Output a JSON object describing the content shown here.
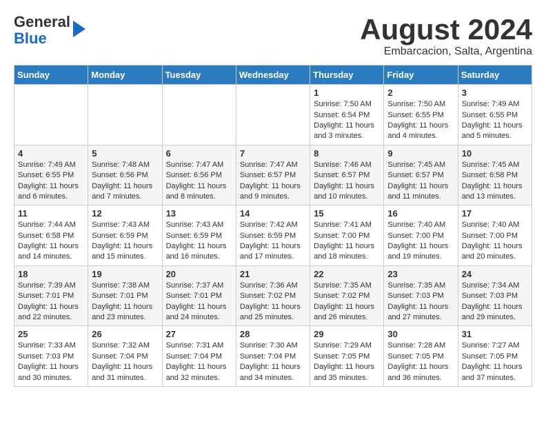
{
  "header": {
    "logo_general": "General",
    "logo_blue": "Blue",
    "month_title": "August 2024",
    "subtitle": "Embarcacion, Salta, Argentina"
  },
  "days_of_week": [
    "Sunday",
    "Monday",
    "Tuesday",
    "Wednesday",
    "Thursday",
    "Friday",
    "Saturday"
  ],
  "weeks": [
    [
      {
        "day": "",
        "content": ""
      },
      {
        "day": "",
        "content": ""
      },
      {
        "day": "",
        "content": ""
      },
      {
        "day": "",
        "content": ""
      },
      {
        "day": "1",
        "content": "Sunrise: 7:50 AM\nSunset: 6:54 PM\nDaylight: 11 hours\nand 3 minutes."
      },
      {
        "day": "2",
        "content": "Sunrise: 7:50 AM\nSunset: 6:55 PM\nDaylight: 11 hours\nand 4 minutes."
      },
      {
        "day": "3",
        "content": "Sunrise: 7:49 AM\nSunset: 6:55 PM\nDaylight: 11 hours\nand 5 minutes."
      }
    ],
    [
      {
        "day": "4",
        "content": "Sunrise: 7:49 AM\nSunset: 6:55 PM\nDaylight: 11 hours\nand 6 minutes."
      },
      {
        "day": "5",
        "content": "Sunrise: 7:48 AM\nSunset: 6:56 PM\nDaylight: 11 hours\nand 7 minutes."
      },
      {
        "day": "6",
        "content": "Sunrise: 7:47 AM\nSunset: 6:56 PM\nDaylight: 11 hours\nand 8 minutes."
      },
      {
        "day": "7",
        "content": "Sunrise: 7:47 AM\nSunset: 6:57 PM\nDaylight: 11 hours\nand 9 minutes."
      },
      {
        "day": "8",
        "content": "Sunrise: 7:46 AM\nSunset: 6:57 PM\nDaylight: 11 hours\nand 10 minutes."
      },
      {
        "day": "9",
        "content": "Sunrise: 7:45 AM\nSunset: 6:57 PM\nDaylight: 11 hours\nand 11 minutes."
      },
      {
        "day": "10",
        "content": "Sunrise: 7:45 AM\nSunset: 6:58 PM\nDaylight: 11 hours\nand 13 minutes."
      }
    ],
    [
      {
        "day": "11",
        "content": "Sunrise: 7:44 AM\nSunset: 6:58 PM\nDaylight: 11 hours\nand 14 minutes."
      },
      {
        "day": "12",
        "content": "Sunrise: 7:43 AM\nSunset: 6:59 PM\nDaylight: 11 hours\nand 15 minutes."
      },
      {
        "day": "13",
        "content": "Sunrise: 7:43 AM\nSunset: 6:59 PM\nDaylight: 11 hours\nand 16 minutes."
      },
      {
        "day": "14",
        "content": "Sunrise: 7:42 AM\nSunset: 6:59 PM\nDaylight: 11 hours\nand 17 minutes."
      },
      {
        "day": "15",
        "content": "Sunrise: 7:41 AM\nSunset: 7:00 PM\nDaylight: 11 hours\nand 18 minutes."
      },
      {
        "day": "16",
        "content": "Sunrise: 7:40 AM\nSunset: 7:00 PM\nDaylight: 11 hours\nand 19 minutes."
      },
      {
        "day": "17",
        "content": "Sunrise: 7:40 AM\nSunset: 7:00 PM\nDaylight: 11 hours\nand 20 minutes."
      }
    ],
    [
      {
        "day": "18",
        "content": "Sunrise: 7:39 AM\nSunset: 7:01 PM\nDaylight: 11 hours\nand 22 minutes."
      },
      {
        "day": "19",
        "content": "Sunrise: 7:38 AM\nSunset: 7:01 PM\nDaylight: 11 hours\nand 23 minutes."
      },
      {
        "day": "20",
        "content": "Sunrise: 7:37 AM\nSunset: 7:01 PM\nDaylight: 11 hours\nand 24 minutes."
      },
      {
        "day": "21",
        "content": "Sunrise: 7:36 AM\nSunset: 7:02 PM\nDaylight: 11 hours\nand 25 minutes."
      },
      {
        "day": "22",
        "content": "Sunrise: 7:35 AM\nSunset: 7:02 PM\nDaylight: 11 hours\nand 26 minutes."
      },
      {
        "day": "23",
        "content": "Sunrise: 7:35 AM\nSunset: 7:03 PM\nDaylight: 11 hours\nand 27 minutes."
      },
      {
        "day": "24",
        "content": "Sunrise: 7:34 AM\nSunset: 7:03 PM\nDaylight: 11 hours\nand 29 minutes."
      }
    ],
    [
      {
        "day": "25",
        "content": "Sunrise: 7:33 AM\nSunset: 7:03 PM\nDaylight: 11 hours\nand 30 minutes."
      },
      {
        "day": "26",
        "content": "Sunrise: 7:32 AM\nSunset: 7:04 PM\nDaylight: 11 hours\nand 31 minutes."
      },
      {
        "day": "27",
        "content": "Sunrise: 7:31 AM\nSunset: 7:04 PM\nDaylight: 11 hours\nand 32 minutes."
      },
      {
        "day": "28",
        "content": "Sunrise: 7:30 AM\nSunset: 7:04 PM\nDaylight: 11 hours\nand 34 minutes."
      },
      {
        "day": "29",
        "content": "Sunrise: 7:29 AM\nSunset: 7:05 PM\nDaylight: 11 hours\nand 35 minutes."
      },
      {
        "day": "30",
        "content": "Sunrise: 7:28 AM\nSunset: 7:05 PM\nDaylight: 11 hours\nand 36 minutes."
      },
      {
        "day": "31",
        "content": "Sunrise: 7:27 AM\nSunset: 7:05 PM\nDaylight: 11 hours\nand 37 minutes."
      }
    ]
  ]
}
